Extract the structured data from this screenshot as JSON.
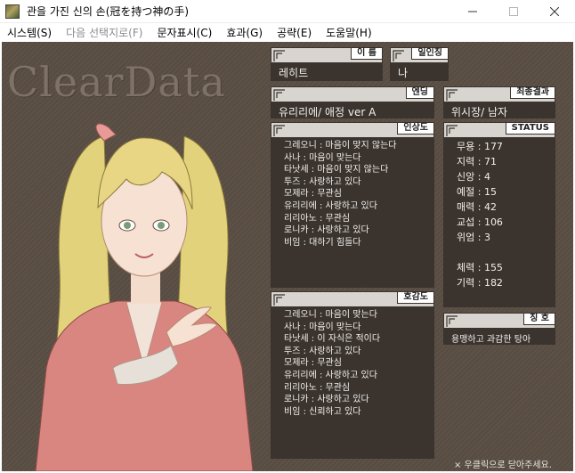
{
  "window": {
    "title": "관을 가진 신의 손(冠を持つ神の手)",
    "min_icon": "minimize-icon",
    "max_icon": "maximize-icon",
    "close_icon": "close-icon"
  },
  "menu": [
    {
      "label": "시스템(S)",
      "enabled": true
    },
    {
      "label": "다음 선택지로(F)",
      "enabled": false
    },
    {
      "label": "문자표시(C)",
      "enabled": true
    },
    {
      "label": "효과(G)",
      "enabled": true
    },
    {
      "label": "공략(E)",
      "enabled": true
    },
    {
      "label": "도움말(H)",
      "enabled": true
    }
  ],
  "watermark": "ClearData",
  "name_panel": {
    "label": "이 름",
    "value": "레히트"
  },
  "person_panel": {
    "label": "일인칭",
    "value": "나"
  },
  "ending_panel": {
    "label": "엔딩",
    "value": "유리리에/ 애정  ver A"
  },
  "final_panel": {
    "label": "최종결과",
    "value": "위시장/ 남자"
  },
  "impression_panel": {
    "label": "인상도",
    "lines": [
      "그레오니 : 마음이 맞지 않는다",
      "사나 : 마음이 맞는다",
      "타낫세 : 마음이 맞지 않는다",
      "투즈 : 사랑하고 있다",
      "모제라 : 무관심",
      "유리리에 : 사랑하고 있다",
      "리리아노 : 무관심",
      "로니카 : 사랑하고 있다",
      "비임 : 대하기 힘들다"
    ]
  },
  "favor_panel": {
    "label": "호감도",
    "lines": [
      "그레오니 : 마음이 맞는다",
      "사나 : 마음이 맞는다",
      "타낫세 : 이 자식은 적이다",
      "투즈 : 사랑하고 있다",
      "모제라 : 무관심",
      "유리리에 : 사랑하고 있다",
      "리리아노 : 무관심",
      "로니카 : 사랑하고 있다",
      "비임 : 신뢰하고 있다"
    ]
  },
  "status_panel": {
    "label": "STATUS",
    "stats": [
      {
        "text": "무용 : 177"
      },
      {
        "text": "지력 : 71"
      },
      {
        "text": "신앙 : 4"
      },
      {
        "text": "예절 : 15"
      },
      {
        "text": "매력 : 42"
      },
      {
        "text": "교섭 : 106"
      },
      {
        "text": "위엄 : 3"
      }
    ],
    "stats2": [
      {
        "text": "체력 : 155"
      },
      {
        "text": "기력 : 182"
      }
    ]
  },
  "title_panel": {
    "label": "칭 호",
    "value": "용맹하고 과감한 탕아"
  },
  "footer_hint": "× 우클릭으로 닫아주세요.",
  "colors": {
    "background": "#5a4e44",
    "panel_body": "#3a332e",
    "panel_frame": "#d8d5d0",
    "text": "#f2f0ee"
  }
}
